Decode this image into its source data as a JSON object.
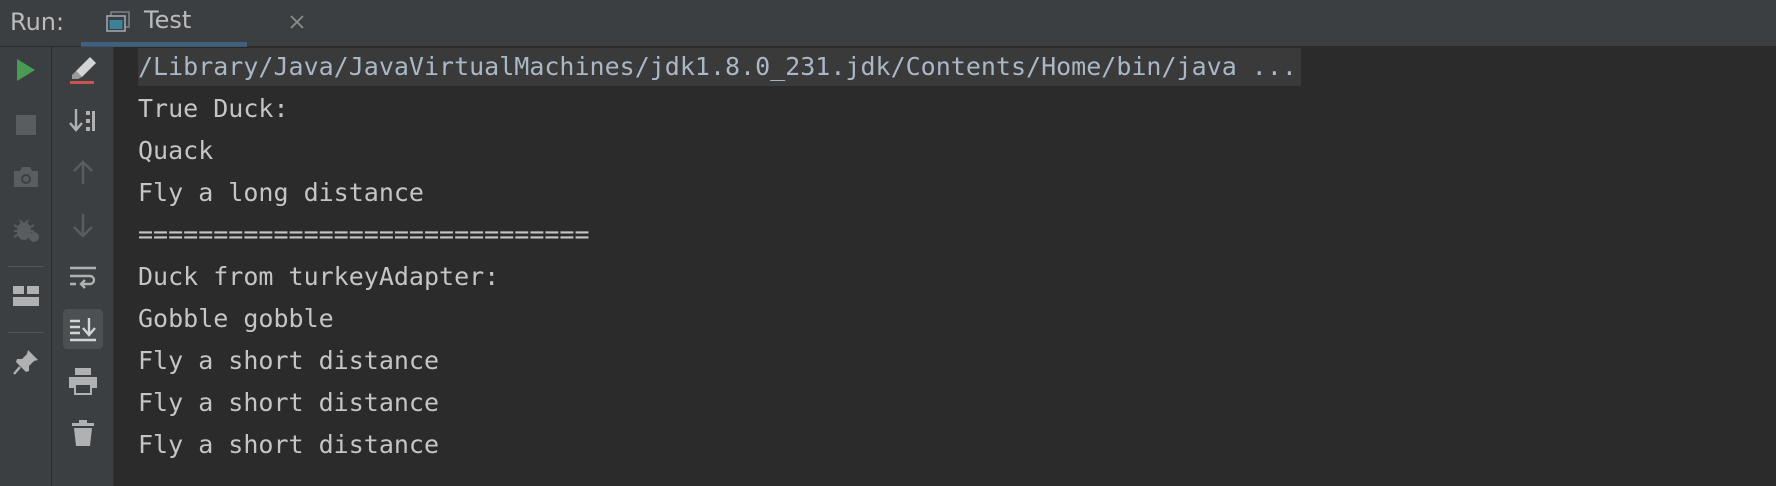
{
  "header": {
    "run_label": "Run:",
    "tab": {
      "label": "Test",
      "icon": "console-window-icon",
      "close_icon": "close-icon"
    }
  },
  "left_toolbar": [
    {
      "name": "rerun-button",
      "icon": "play-icon",
      "color": "#499c54"
    },
    {
      "name": "stop-button",
      "icon": "stop-square-icon",
      "disabled": true
    },
    {
      "name": "dump-threads-button",
      "icon": "camera-icon",
      "disabled": true
    },
    {
      "name": "debug-button",
      "icon": "bug-icon",
      "disabled": true
    },
    {
      "name": "restore-layout-button",
      "icon": "layout-icon"
    },
    {
      "name": "pin-tab-button",
      "icon": "pin-icon"
    }
  ],
  "console_toolbar": [
    {
      "name": "clear-highlight-button",
      "icon": "eraser-icon"
    },
    {
      "name": "sort-button",
      "icon": "sort-down-icon"
    },
    {
      "name": "previous-occurrence-button",
      "icon": "arrow-up-icon",
      "disabled": true
    },
    {
      "name": "next-occurrence-button",
      "icon": "arrow-down-icon",
      "disabled": true
    },
    {
      "name": "soft-wrap-button",
      "icon": "soft-wrap-icon"
    },
    {
      "name": "scroll-to-end-button",
      "icon": "scroll-to-end-icon",
      "active": true
    },
    {
      "name": "print-button",
      "icon": "printer-icon"
    },
    {
      "name": "clear-all-button",
      "icon": "trash-icon"
    }
  ],
  "console": {
    "command": "/Library/Java/JavaVirtualMachines/jdk1.8.0_231.jdk/Contents/Home/bin/java ...",
    "lines": [
      "True Duck:",
      "Quack",
      "Fly a long distance",
      "==============================",
      "Duck from turkeyAdapter:",
      "Gobble gobble",
      "Fly a short distance",
      "Fly a short distance",
      "Fly a short distance"
    ]
  },
  "colors": {
    "panel_bg": "#3c3f41",
    "console_bg": "#2b2b2b",
    "text": "#c5c5c5",
    "run_green": "#499c54",
    "eraser_red": "#c75450",
    "tab_underline": "#4a88c7"
  }
}
